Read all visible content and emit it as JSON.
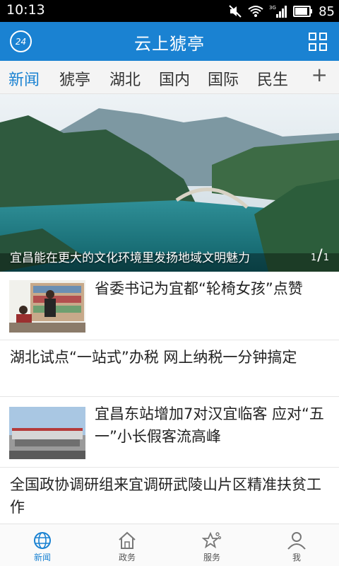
{
  "status_bar": {
    "time": "10:13",
    "signal_label": "3G",
    "battery_level": "85"
  },
  "header": {
    "badge": "24",
    "title": "云上猇亭"
  },
  "tabs": [
    "新闻",
    "猇亭",
    "湖北",
    "国内",
    "国际",
    "民生"
  ],
  "add_tab_symbol": "+",
  "hero": {
    "caption": "宜昌能在更大的文化环境里发扬地域文明魅力",
    "page_current": "1",
    "page_total": "1"
  },
  "news": [
    {
      "title": "省委书记为宜都“轮椅女孩”点赞"
    },
    {
      "title": "湖北试点“一站式”办税 网上纳税一分钟搞定"
    },
    {
      "title": "宜昌东站增加7对汉宜临客 应对“五一”小长假客流高峰"
    },
    {
      "title": "全国政协调研组来宜调研武陵山片区精准扶贫工作"
    }
  ],
  "bottom_nav": [
    {
      "label": "新闻",
      "icon": "globe-icon"
    },
    {
      "label": "政务",
      "icon": "house-icon"
    },
    {
      "label": "服务",
      "icon": "star-icon"
    },
    {
      "label": "我",
      "icon": "person-icon"
    }
  ],
  "colors": {
    "accent": "#1a82d2",
    "statusbar": "#000000"
  }
}
